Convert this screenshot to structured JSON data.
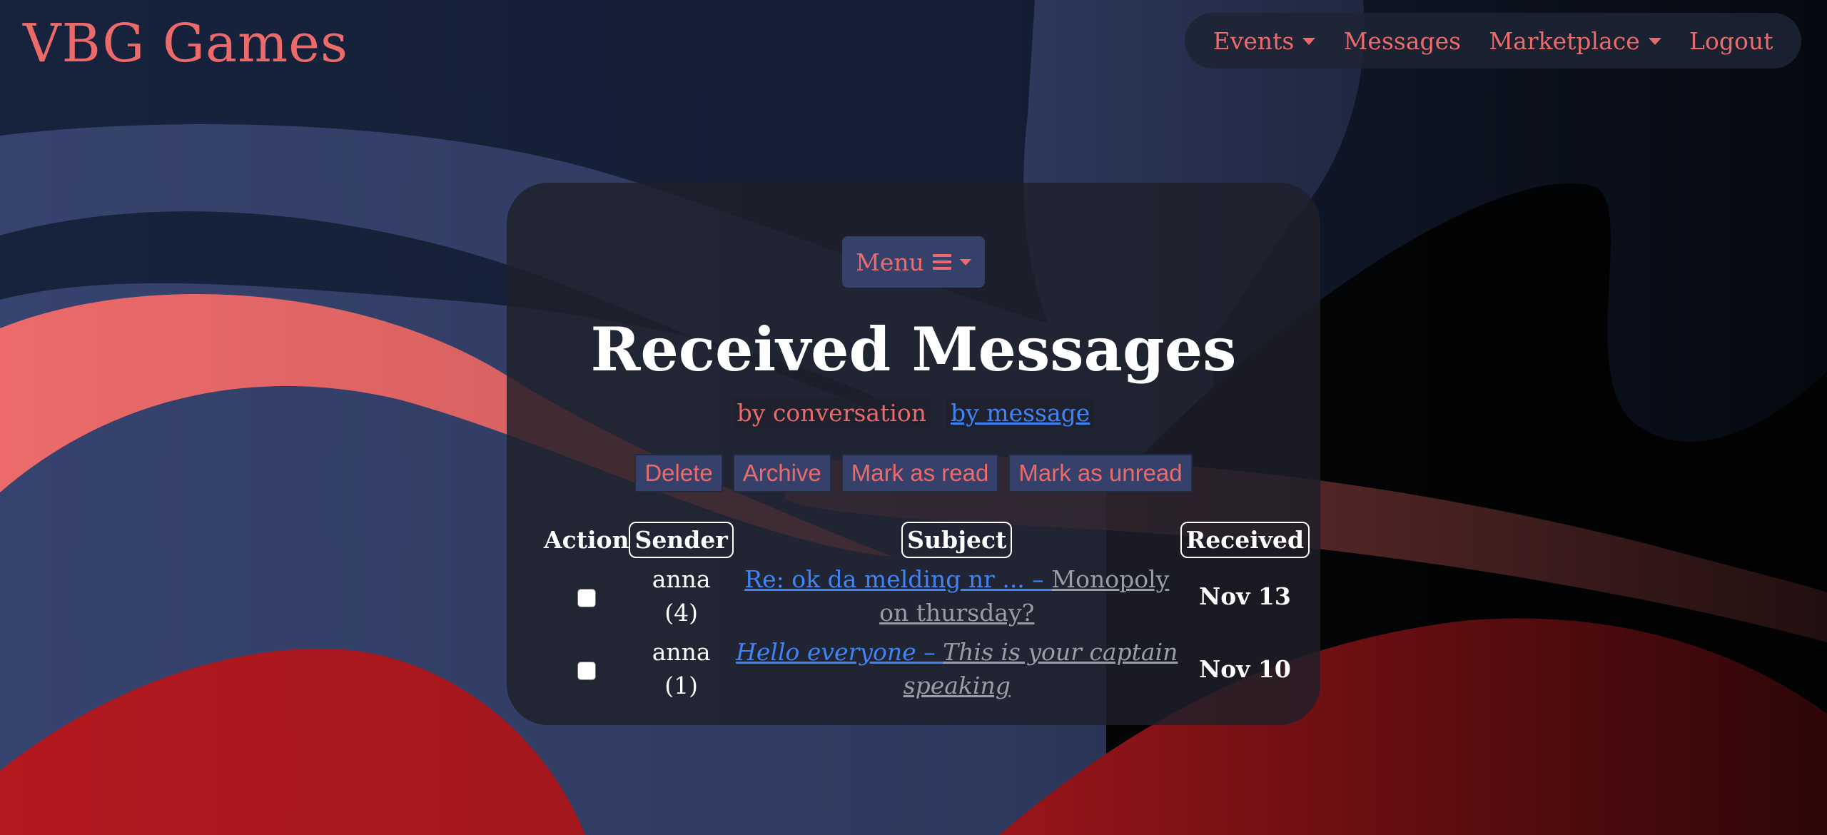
{
  "brand": {
    "title": "VBG Games"
  },
  "nav": {
    "events": "Events",
    "messages": "Messages",
    "marketplace": "Marketplace",
    "logout": "Logout"
  },
  "menu_button": "Menu",
  "page_title": "Received Messages",
  "view_toggle": {
    "by_conversation": "by conversation",
    "by_message": "by message"
  },
  "actions": {
    "delete": "Delete",
    "archive": "Archive",
    "mark_read": "Mark as read",
    "mark_unread": "Mark as unread"
  },
  "table": {
    "headers": {
      "action": "Action",
      "sender": "Sender",
      "subject": "Subject",
      "received": "Received"
    },
    "rows": [
      {
        "sender": "anna",
        "count": "(4)",
        "subject": "Re: ok da melding nr ...",
        "separator": " – ",
        "preview": "Monopoly on thursday?",
        "received": "Nov 13",
        "italic": false
      },
      {
        "sender": "anna",
        "count": "(1)",
        "subject": "Hello everyone",
        "separator": " – ",
        "preview": "This is your captain speaking",
        "received": "Nov 10",
        "italic": true
      }
    ]
  },
  "colors": {
    "background": "#17233d",
    "accent": "#ec6a6a",
    "link": "#3f84f5",
    "button_bg": "#35416b"
  }
}
